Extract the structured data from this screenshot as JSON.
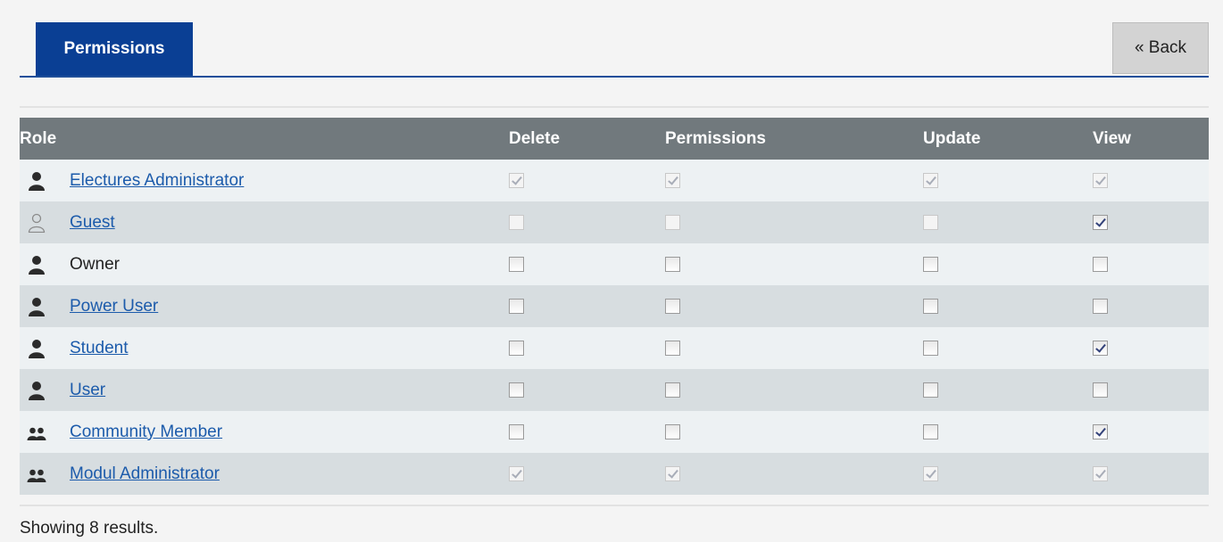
{
  "tabs": [
    {
      "label": "Permissions"
    }
  ],
  "back_label": "« Back",
  "columns": [
    "Role",
    "Delete",
    "Permissions",
    "Update",
    "View"
  ],
  "rows": [
    {
      "role": "Electures Administrator",
      "link": true,
      "icon": "user-dark-icon",
      "delete": true,
      "permissions": true,
      "update": true,
      "view": true,
      "disabled": true
    },
    {
      "role": "Guest",
      "link": true,
      "icon": "user-outline-icon",
      "delete": false,
      "permissions": false,
      "update": false,
      "view": true,
      "disabled_cols": [
        "delete",
        "permissions",
        "update"
      ]
    },
    {
      "role": "Owner",
      "link": false,
      "icon": "user-dark-icon",
      "delete": false,
      "permissions": false,
      "update": false,
      "view": false
    },
    {
      "role": "Power User",
      "link": true,
      "icon": "user-dark-icon",
      "delete": false,
      "permissions": false,
      "update": false,
      "view": false
    },
    {
      "role": "Student",
      "link": true,
      "icon": "user-dark-icon",
      "delete": false,
      "permissions": false,
      "update": false,
      "view": true
    },
    {
      "role": "User",
      "link": true,
      "icon": "user-dark-icon",
      "delete": false,
      "permissions": false,
      "update": false,
      "view": false
    },
    {
      "role": "Community Member",
      "link": true,
      "icon": "user-group-icon",
      "delete": false,
      "permissions": false,
      "update": false,
      "view": true
    },
    {
      "role": "Modul Administrator",
      "link": true,
      "icon": "user-group-icon",
      "delete": true,
      "permissions": true,
      "update": true,
      "view": true,
      "disabled": true
    }
  ],
  "footer": "Showing 8 results."
}
